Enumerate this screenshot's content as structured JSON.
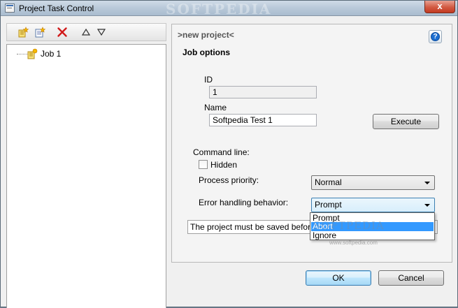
{
  "window": {
    "title": "Project Task Control",
    "close_glyph": "x",
    "watermark": "SOFTPEDIA"
  },
  "toolbar": {
    "icons": [
      "new-job-icon",
      "edit-job-icon",
      "delete-icon",
      "move-up-icon",
      "move-down-icon"
    ],
    "delete_color": "#d11a1a"
  },
  "tree": {
    "items": [
      {
        "label": "Job 1",
        "icon": "job-icon"
      }
    ]
  },
  "panel": {
    "header": ">new project<",
    "help_glyph": "?",
    "section_title": "Job options",
    "id_label": "ID",
    "id_value": "1",
    "name_label": "Name",
    "name_value": "Softpedia Test 1",
    "execute_label": "Execute",
    "command_line_label": "Command line:",
    "hidden_label": "Hidden",
    "hidden_checked": false,
    "priority_label": "Process priority:",
    "priority_value": "Normal",
    "error_label": "Error handling behavior:",
    "error_value": "Prompt",
    "message": "The project must be saved before g"
  },
  "dropdown": {
    "options": [
      "Prompt",
      "Abort",
      "Ignore"
    ],
    "selected": "Abort",
    "watermark": "SOFTPEDIA",
    "watermark_sub": "www.softpedia.com"
  },
  "footer": {
    "ok_label": "OK",
    "cancel_label": "Cancel"
  }
}
